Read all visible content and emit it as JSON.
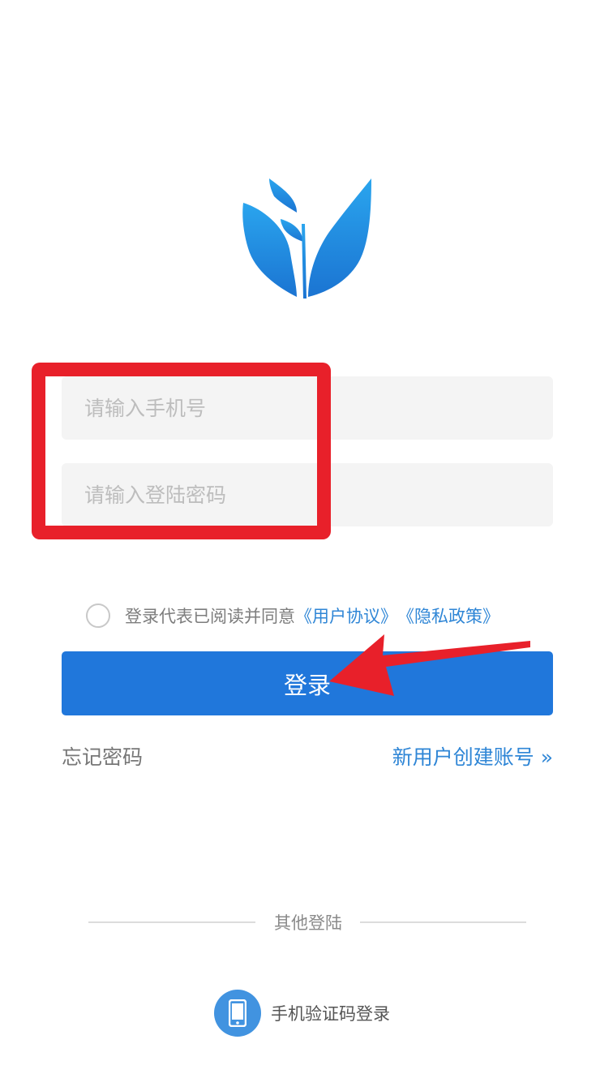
{
  "login_form": {
    "phone_placeholder": "请输入手机号",
    "password_placeholder": "请输入登陆密码"
  },
  "agreement": {
    "prefix": "登录代表已阅读并同意",
    "user_agreement": "《用户协议》",
    "privacy_policy": "《隐私政策》",
    "checked": false
  },
  "login_button_label": "登录",
  "links": {
    "forgot_password": "忘记密码",
    "create_account": "新用户创建账号 »"
  },
  "other_login": {
    "divider_label": "其他登陆",
    "sms_login_label": "手机验证码登录",
    "sms_icon": "phone-icon"
  },
  "annotations": {
    "highlight_color": "#e8202a",
    "arrow_color": "#e8202a"
  },
  "colors": {
    "primary": "#2077db",
    "link": "#2f86d6",
    "logo_gradient": [
      "#2a9be8",
      "#1b78d4"
    ]
  },
  "logo_icon": "sprout-leaf-logo-icon"
}
